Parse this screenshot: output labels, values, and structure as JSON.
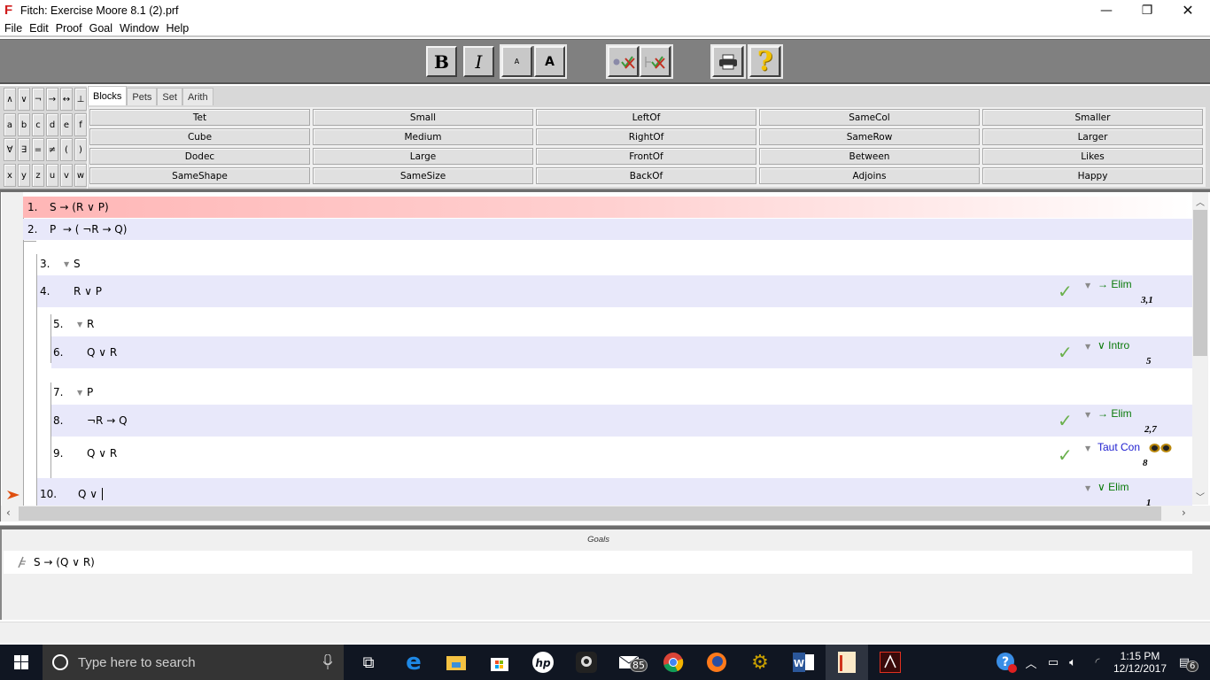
{
  "window": {
    "title": "Fitch: Exercise Moore 8.1 (2).prf",
    "app_icon": "F",
    "controls": {
      "minimize": "—",
      "restore": "❐",
      "close": "✕"
    }
  },
  "menu": [
    "File",
    "Edit",
    "Proof",
    "Goal",
    "Window",
    "Help"
  ],
  "toolbar": {
    "bold": "B",
    "italic": "I",
    "smaller_font": "A",
    "larger_font": "A",
    "check_step_icon": "check-step",
    "check_goal_icon": "check-goal",
    "print_icon": "printer",
    "help_icon": "?"
  },
  "symbols": [
    [
      "∧",
      "∨",
      "¬",
      "→",
      "↔",
      "⊥"
    ],
    [
      "a",
      "b",
      "c",
      "d",
      "e",
      "f"
    ],
    [
      "∀",
      "∃",
      "=",
      "≠",
      "(",
      ")"
    ],
    [
      "x",
      "y",
      "z",
      "u",
      "v",
      "w"
    ]
  ],
  "predicate_tabs": [
    {
      "label": "Blocks",
      "active": true
    },
    {
      "label": "Pets",
      "active": false
    },
    {
      "label": "Set",
      "active": false
    },
    {
      "label": "Arith",
      "active": false
    }
  ],
  "predicates": [
    [
      "Tet",
      "Small",
      "LeftOf",
      "SameCol",
      "Smaller"
    ],
    [
      "Cube",
      "Medium",
      "RightOf",
      "SameRow",
      "Larger"
    ],
    [
      "Dodec",
      "Large",
      "FrontOf",
      "Between",
      "Likes"
    ],
    [
      "SameShape",
      "SameSize",
      "BackOf",
      "Adjoins",
      "Happy"
    ]
  ],
  "proof": {
    "lines": [
      {
        "num": "1.",
        "formula": "S → (R ∨ P)",
        "type": "premise"
      },
      {
        "num": "2.",
        "formula": "P  → ( ¬R → Q)",
        "type": "premise"
      },
      {
        "num": "3.",
        "formula": "S",
        "type": "assumption"
      },
      {
        "num": "4.",
        "formula": "R ∨ P",
        "rule": "→ Elim",
        "cite": "3,1",
        "checked": true
      },
      {
        "num": "5.",
        "formula": "R",
        "type": "assumption"
      },
      {
        "num": "6.",
        "formula": "Q ∨ R",
        "rule": "∨ Intro",
        "cite": "5",
        "checked": true
      },
      {
        "num": "7.",
        "formula": "P",
        "type": "assumption"
      },
      {
        "num": "8.",
        "formula": "¬R → Q",
        "rule": "→ Elim",
        "cite": "2,7",
        "checked": true
      },
      {
        "num": "9.",
        "formula": "Q ∨ R",
        "rule": "Taut Con",
        "cite": "8",
        "checked": true
      },
      {
        "num": "10.",
        "formula": "Q ∨ ",
        "rule": "∨ Elim",
        "cite": "1",
        "checked": false
      }
    ]
  },
  "goals": {
    "title": "Goals",
    "items": [
      {
        "formula": "S → (Q ∨ R)"
      }
    ]
  },
  "taskbar": {
    "search_placeholder": "Type here to search",
    "mail_badge": "85",
    "time": "1:15 PM",
    "date": "12/12/2017",
    "notification_count": "6"
  }
}
